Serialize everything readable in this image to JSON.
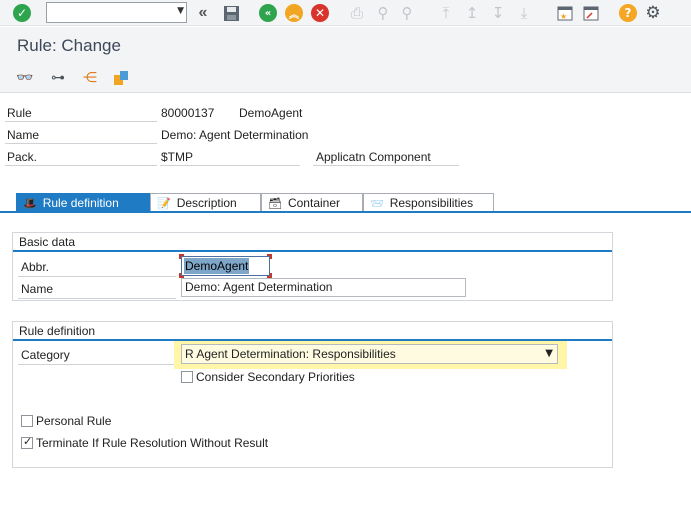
{
  "toolbar": {
    "command_value": "",
    "icons": [
      "enter-check-icon",
      "command-dropdown-icon",
      "history-back-icon",
      "save-icon",
      "back-icon",
      "exit-icon",
      "cancel-icon",
      "print-icon",
      "find-icon",
      "find-next-icon",
      "first-page-icon",
      "previous-page-icon",
      "next-page-icon",
      "last-page-icon",
      "new-session-icon",
      "shortcut-icon",
      "help-icon",
      "settings-gear-icon"
    ],
    "colors": {
      "green": "#2ea44f",
      "orange": "#f0a623",
      "red": "#d9342b",
      "help": "#f5a623"
    }
  },
  "title": "Rule: Change",
  "header": {
    "rule_label": "Rule",
    "rule_id": "80000137",
    "rule_abbr": "DemoAgent",
    "name_label": "Name",
    "name_value": "Demo: Agent Determination",
    "pack_label": "Pack.",
    "pack_value": "$TMP",
    "component_label": "Applicatn Component"
  },
  "tabs": [
    {
      "label": "Rule definition",
      "icon": "hat-icon",
      "active": true
    },
    {
      "label": "Description",
      "icon": "document-icon",
      "active": false
    },
    {
      "label": "Container",
      "icon": "container-icon",
      "active": false
    },
    {
      "label": "Responsibilities",
      "icon": "responsibilities-icon",
      "active": false
    }
  ],
  "basic_data": {
    "title": "Basic data",
    "abbr_label": "Abbr.",
    "abbr_value": "DemoAgent",
    "name_label": "Name",
    "name_value": "Demo: Agent Determination"
  },
  "rule_definition": {
    "title": "Rule definition",
    "category_label": "Category",
    "category_value": "R Agent Determination: Responsibilities",
    "consider_secondary_label": "Consider Secondary Priorities",
    "consider_secondary_checked": false,
    "personal_rule_label": "Personal Rule",
    "personal_rule_checked": false,
    "terminate_label": "Terminate If Rule Resolution Without Result",
    "terminate_checked": true
  }
}
